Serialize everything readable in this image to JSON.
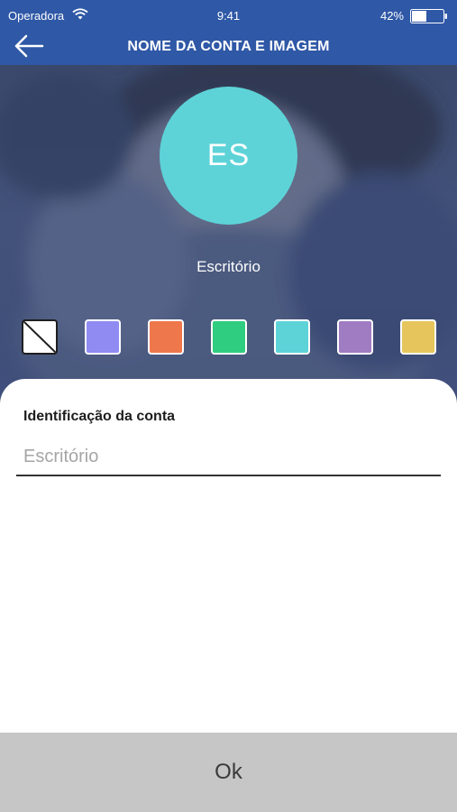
{
  "status_bar": {
    "carrier": "Operadora",
    "time": "9:41",
    "battery": "42%",
    "icons": [
      "wifi-icon",
      "battery-icon"
    ]
  },
  "nav": {
    "title": "NOME DA CONTA E IMAGEM",
    "back_icon": "back-arrow-icon"
  },
  "avatar": {
    "initials": "ES",
    "name": "Escritório",
    "color": "#5dd3d8"
  },
  "color_options": [
    {
      "name": "none",
      "color": "#ffffff"
    },
    {
      "name": "periwinkle",
      "color": "#8f8bf2"
    },
    {
      "name": "orange",
      "color": "#ef774c"
    },
    {
      "name": "green",
      "color": "#2fcd80"
    },
    {
      "name": "cyan",
      "color": "#5dd3d8"
    },
    {
      "name": "purple",
      "color": "#a07cc3"
    },
    {
      "name": "yellow",
      "color": "#e6c65c"
    }
  ],
  "form": {
    "label": "Identificação da conta",
    "placeholder": "Escritório",
    "value": ""
  },
  "ok_button": {
    "label": "Ok"
  },
  "colors": {
    "header": "#2f58a6",
    "button_bg": "#c6c6c6"
  }
}
